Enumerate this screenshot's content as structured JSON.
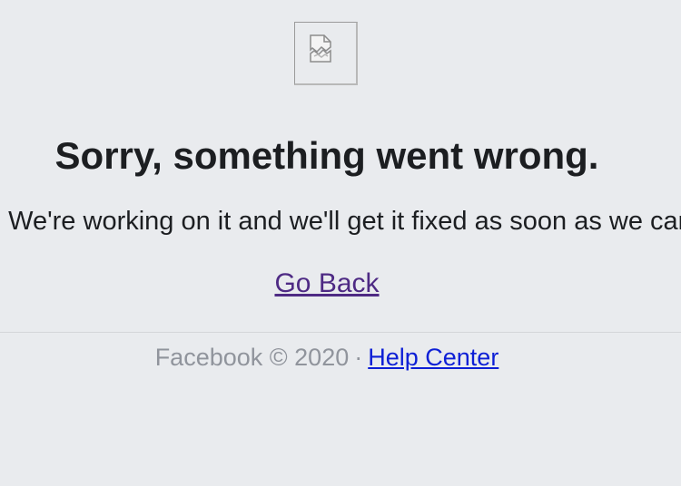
{
  "error_page": {
    "broken_image_icon": "broken-image-icon",
    "title": "Sorry, something went wrong.",
    "message": "We're working on it and we'll get it fixed as soon as we can.",
    "go_back_label": "Go Back"
  },
  "footer": {
    "copyright": "Facebook © 2020",
    "separator": "·",
    "help_center_label": "Help Center"
  },
  "colors": {
    "background": "#e9ebee",
    "text": "#1c1e21",
    "visited_link": "#4e2a84",
    "link": "#0d1fd6",
    "muted": "#90949c"
  }
}
